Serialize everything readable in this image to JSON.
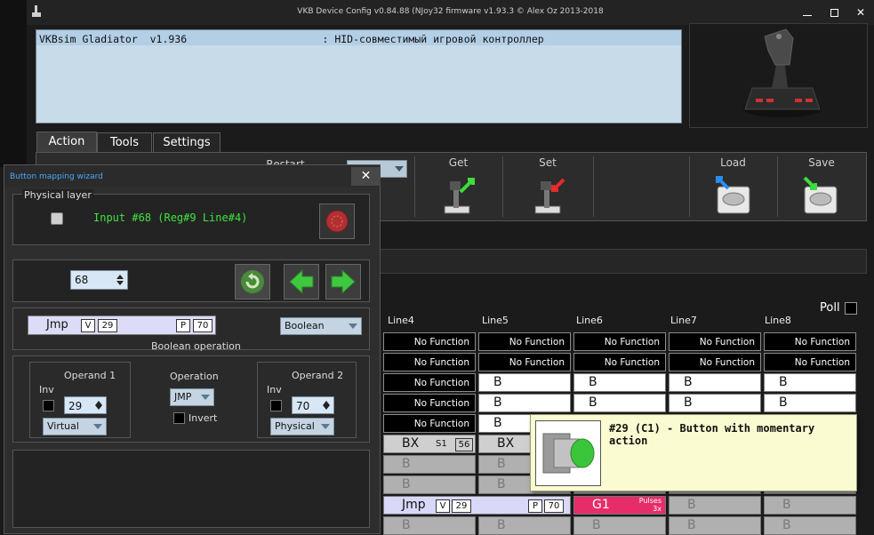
{
  "window": {
    "title": "VKB Device Config v0.84.88 (NJoy32 firmware v1.93.3 © Alex Oz 2013-2018",
    "info_line": "VKBsim Gladiator  v1.936                      : HID-совместимый игровой контроллер"
  },
  "tabs": [
    {
      "label": "Action",
      "active": true
    },
    {
      "label": "Tools",
      "active": false
    },
    {
      "label": "Settings",
      "active": false
    }
  ],
  "toolbar": {
    "restart_label": "Restart",
    "get_label": "Get",
    "set_label": "Set",
    "load_label": "Load",
    "save_label": "Save"
  },
  "poll": {
    "label": "Poll"
  },
  "columns": [
    "Line4",
    "Line5",
    "Line6",
    "Line7",
    "Line8"
  ],
  "grid": {
    "no_function": "No Function",
    "b": "B",
    "bx": "BX",
    "s1": "S1",
    "s1_value": "56",
    "jmp": "Jmp",
    "jmp_v": "V",
    "jmp_29": "29",
    "jmp_p": "P",
    "jmp_70": "70",
    "g1": "G1",
    "pulses": "Pulses",
    "pulses_count": "3x"
  },
  "tooltip": {
    "text": "#29 (C1) - Button with momentary action"
  },
  "wizard": {
    "title": "Button mapping wizard",
    "close": "✕",
    "physical_layer": "Physical layer",
    "input_text": "Input #68 (Reg#9  Line#4)",
    "number_value": "68",
    "function": {
      "name": "Jmp",
      "v": "V",
      "v_value": "29",
      "p": "P",
      "p_value": "70"
    },
    "mode": "Boolean",
    "operation_caption": "Boolean operation",
    "operand1": {
      "label": "Operand 1",
      "inv": "Inv",
      "value": "29",
      "type": "Virtual"
    },
    "operation": {
      "label": "Operation",
      "value": "JMP",
      "invert": "Invert"
    },
    "operand2": {
      "label": "Operand 2",
      "inv": "Inv",
      "value": "70",
      "type": "Physical"
    }
  },
  "colors": {
    "accent_blue": "#4aa8ff",
    "input_green": "#3fe23f",
    "g1_pink": "#e72d69",
    "info_bg": "#c8dbe8",
    "tooltip_bg": "#fbfbd2"
  }
}
